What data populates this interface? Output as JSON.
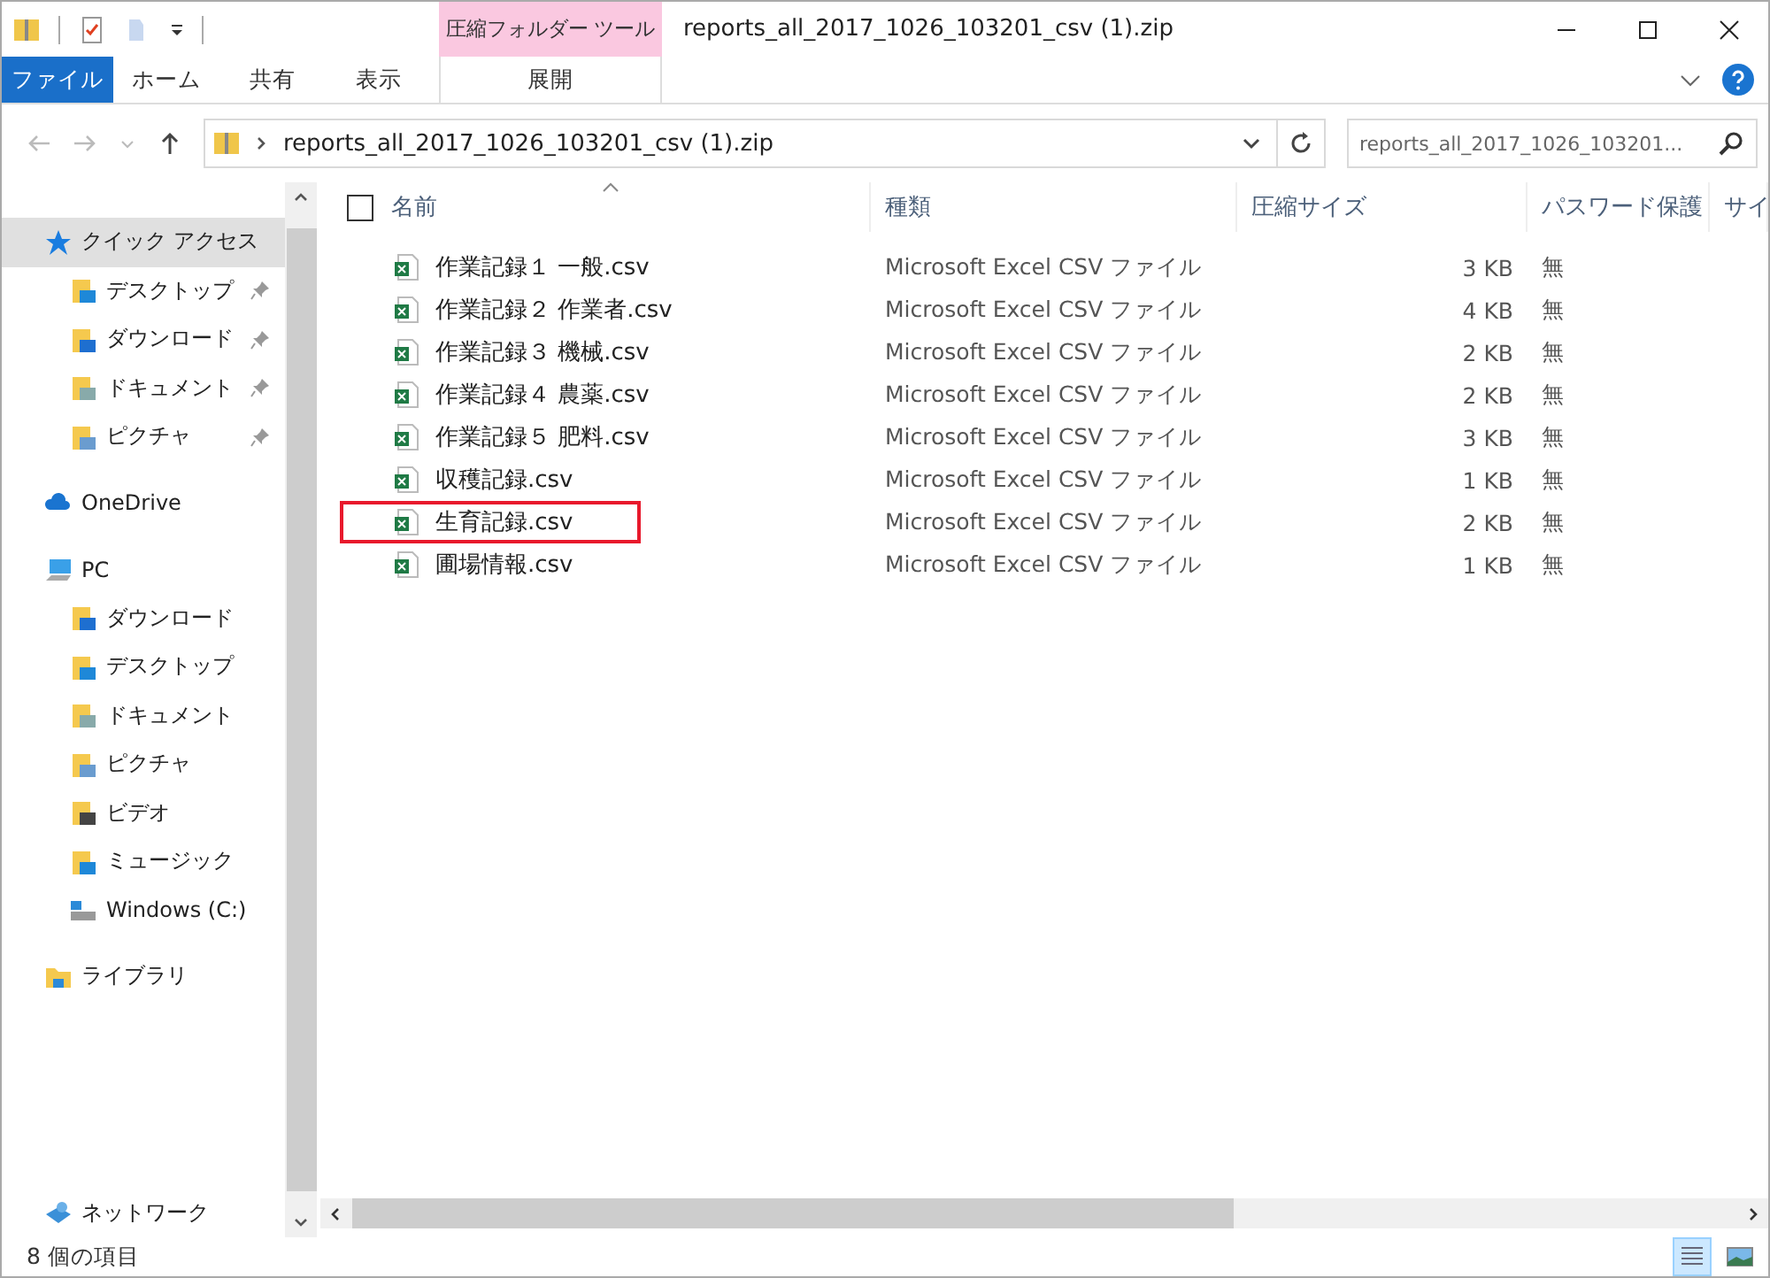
{
  "window": {
    "title": "reports_all_2017_1026_103201_csv (1).zip",
    "context_tab": "圧縮フォルダー ツール"
  },
  "ribbon_tabs": [
    {
      "label": "ファイル",
      "kind": "file",
      "selected": false
    },
    {
      "label": "ホーム",
      "kind": "tab",
      "selected": false
    },
    {
      "label": "共有",
      "kind": "tab",
      "selected": false
    },
    {
      "label": "表示",
      "kind": "tab",
      "selected": false
    },
    {
      "label": "展開",
      "kind": "context",
      "selected": false
    }
  ],
  "address": {
    "path": "reports_all_2017_1026_103201_csv (1).zip"
  },
  "search": {
    "placeholder": "reports_all_2017_1026_103201..."
  },
  "sidebar": {
    "items": [
      {
        "label": "クイック アクセス",
        "kind": "star",
        "selected": true,
        "children": [
          {
            "label": "デスクトップ",
            "kind": "desktop",
            "pinned": true,
            "selected": false
          },
          {
            "label": "ダウンロード",
            "kind": "download",
            "pinned": true,
            "selected": false
          },
          {
            "label": "ドキュメント",
            "kind": "document",
            "pinned": true,
            "selected": false
          },
          {
            "label": "ピクチャ",
            "kind": "picture",
            "pinned": true,
            "selected": false
          }
        ]
      },
      {
        "label": "OneDrive",
        "kind": "cloud",
        "selected": false
      },
      {
        "label": "PC",
        "kind": "pc",
        "selected": false,
        "children": [
          {
            "label": "ダウンロード",
            "kind": "download",
            "pinned": false,
            "selected": false
          },
          {
            "label": "デスクトップ",
            "kind": "desktop",
            "pinned": false,
            "selected": false
          },
          {
            "label": "ドキュメント",
            "kind": "document",
            "pinned": false,
            "selected": false
          },
          {
            "label": "ピクチャ",
            "kind": "picture",
            "pinned": false,
            "selected": false
          },
          {
            "label": "ビデオ",
            "kind": "video",
            "pinned": false,
            "selected": false
          },
          {
            "label": "ミュージック",
            "kind": "music",
            "pinned": false,
            "selected": false
          },
          {
            "label": "Windows (C:)",
            "kind": "drive",
            "pinned": false,
            "selected": false
          }
        ]
      },
      {
        "label": "ライブラリ",
        "kind": "library",
        "selected": false
      },
      {
        "label": "ネットワーク",
        "kind": "network",
        "selected": false
      }
    ]
  },
  "table": {
    "select_all_checked": false,
    "columns": [
      "名前",
      "種類",
      "圧縮サイズ",
      "パスワード保護",
      "サイ"
    ],
    "rows": [
      {
        "name": "作業記録１ 一般.csv",
        "type": "Microsoft Excel CSV ファイル",
        "compressed": "3 KB",
        "password": "無",
        "highlighted": false
      },
      {
        "name": "作業記録２ 作業者.csv",
        "type": "Microsoft Excel CSV ファイル",
        "compressed": "4 KB",
        "password": "無",
        "highlighted": false
      },
      {
        "name": "作業記録３ 機械.csv",
        "type": "Microsoft Excel CSV ファイル",
        "compressed": "2 KB",
        "password": "無",
        "highlighted": false
      },
      {
        "name": "作業記録４ 農薬.csv",
        "type": "Microsoft Excel CSV ファイル",
        "compressed": "2 KB",
        "password": "無",
        "highlighted": false
      },
      {
        "name": "作業記録５ 肥料.csv",
        "type": "Microsoft Excel CSV ファイル",
        "compressed": "3 KB",
        "password": "無",
        "highlighted": false
      },
      {
        "name": "収穫記録.csv",
        "type": "Microsoft Excel CSV ファイル",
        "compressed": "1 KB",
        "password": "無",
        "highlighted": false
      },
      {
        "name": "生育記録.csv",
        "type": "Microsoft Excel CSV ファイル",
        "compressed": "2 KB",
        "password": "無",
        "highlighted": true
      },
      {
        "name": "圃場情報.csv",
        "type": "Microsoft Excel CSV ファイル",
        "compressed": "1 KB",
        "password": "無",
        "highlighted": false
      }
    ]
  },
  "status_bar": {
    "count": "8 個の項目"
  }
}
